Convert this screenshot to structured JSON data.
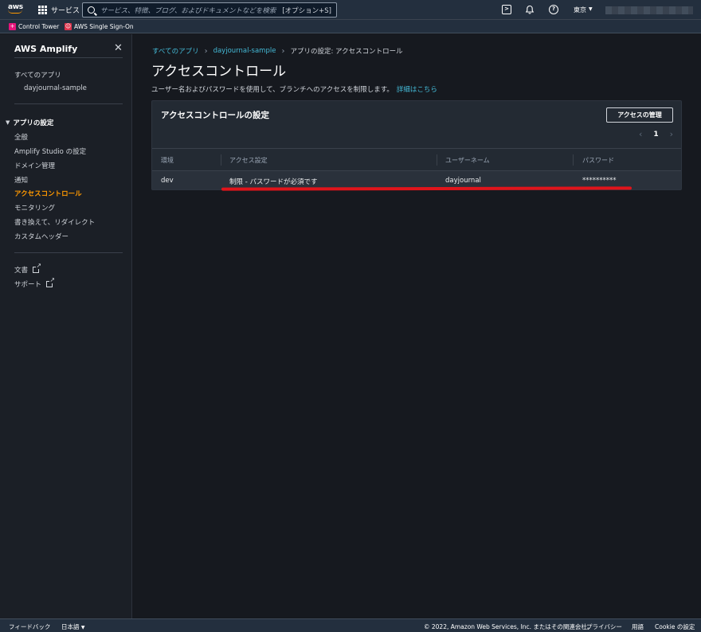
{
  "topnav": {
    "logo_text": "aws",
    "services_label": "サービス",
    "search_placeholder": "サービス、特徴、ブログ、およびドキュメントなどを検索",
    "search_shortcut": "[オプション+S]",
    "region_label": "東京",
    "region_caret": "▼"
  },
  "favorites": [
    {
      "label": "Control Tower",
      "icon": "control-tower-icon"
    },
    {
      "label": "AWS Single Sign-On",
      "icon": "sso-icon"
    }
  ],
  "sidebar": {
    "title": "AWS Amplify",
    "all_apps": "すべてのアプリ",
    "app_name": "dayjournal-sample",
    "group_label": "アプリの設定",
    "items": [
      {
        "label": "全般"
      },
      {
        "label": "Amplify Studio の設定"
      },
      {
        "label": "ドメイン管理"
      },
      {
        "label": "通知"
      },
      {
        "label": "アクセスコントロール",
        "active": true
      },
      {
        "label": "モニタリング"
      },
      {
        "label": "書き換えて、リダイレクト"
      },
      {
        "label": "カスタムヘッダー"
      }
    ],
    "docs_label": "文書",
    "support_label": "サポート"
  },
  "breadcrumb": {
    "items": [
      "すべてのアプリ",
      "dayjournal-sample",
      "アプリの設定: アクセスコントロール"
    ]
  },
  "page": {
    "title": "アクセスコントロール",
    "description": "ユーザー名およびパスワードを使用して、ブランチへのアクセスを制限します。",
    "learn_more": "詳細はこちら"
  },
  "panel": {
    "title": "アクセスコントロールの設定",
    "manage_button": "アクセスの管理",
    "page_number": "1",
    "columns": [
      "環境",
      "アクセス設定",
      "ユーザーネーム",
      "パスワード"
    ],
    "rows": [
      {
        "env": "dev",
        "access": "制限 - パスワードが必須です",
        "username": "dayjournal",
        "password": "**********"
      }
    ]
  },
  "footer": {
    "feedback": "フィードバック",
    "language": "日本語",
    "copyright": "© 2022, Amazon Web Services, Inc. またはその関連会社。",
    "privacy": "プライバシー",
    "terms": "用語",
    "cookie": "Cookie の設定"
  },
  "colors": {
    "accent": "#ff9900",
    "link": "#44b9d6",
    "highlight": "#e0141b"
  }
}
